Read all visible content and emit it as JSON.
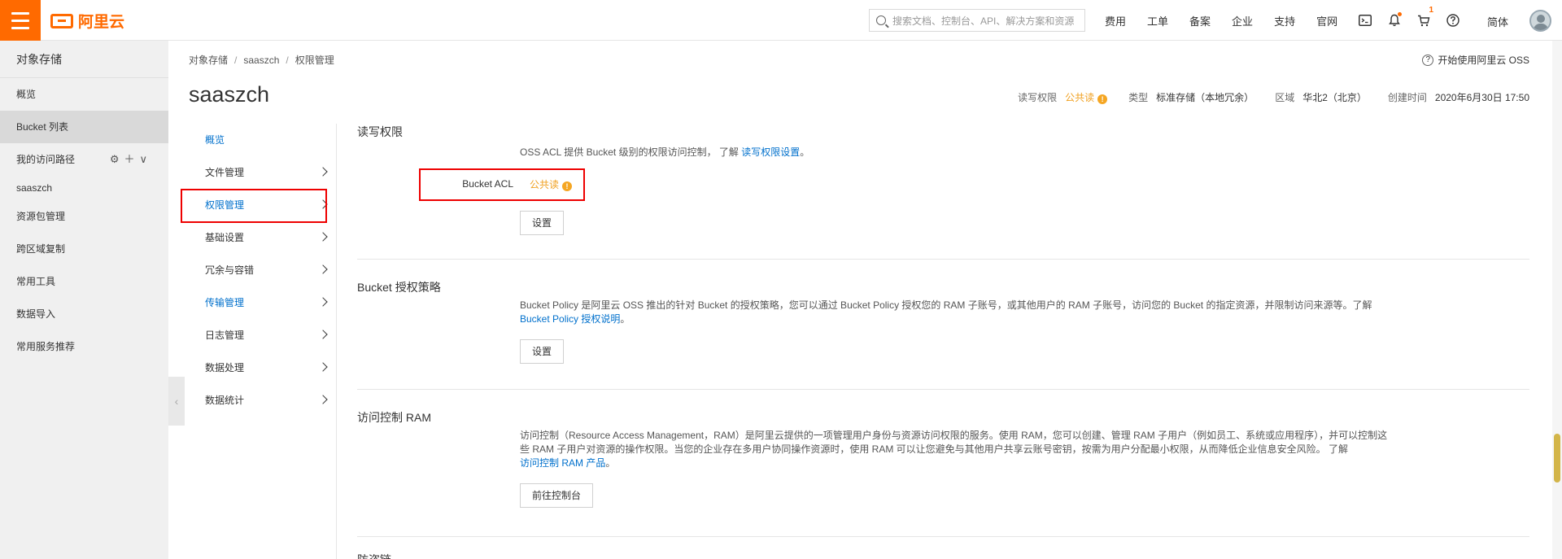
{
  "topbar": {
    "logo_text": "阿里云",
    "search_placeholder": "搜索文档、控制台、API、解决方案和资源",
    "nav": [
      "费用",
      "工单",
      "备案",
      "企业",
      "支持",
      "官网"
    ],
    "cart_badge": "1",
    "lang": "简体"
  },
  "sidebar": {
    "title": "对象存储",
    "items": {
      "overview": "概览",
      "bucket_list": "Bucket 列表",
      "my_paths": "我的访问路径",
      "path_bucket": "saaszch",
      "resource_pkg": "资源包管理",
      "cross_region": "跨区域复制",
      "tools": "常用工具",
      "import": "数据导入",
      "services": "常用服务推荐"
    }
  },
  "breadcrumb": [
    "对象存储",
    "saaszch",
    "权限管理"
  ],
  "help_link": "开始使用阿里云 OSS",
  "page_title": "saaszch",
  "meta": {
    "acl_label": "读写权限",
    "acl_value": "公共读",
    "type_label": "类型",
    "type_value": "标准存储（本地冗余）",
    "region_label": "区域",
    "region_value": "华北2（北京）",
    "created_label": "创建时间",
    "created_value": "2020年6月30日 17:50"
  },
  "subnav": [
    "概览",
    "文件管理",
    "权限管理",
    "基础设置",
    "冗余与容错",
    "传输管理",
    "日志管理",
    "数据处理",
    "数据统计"
  ],
  "sections": {
    "acl": {
      "title": "读写权限",
      "desc": "OSS ACL 提供 Bucket 级别的权限访问控制， 了解 ",
      "desc_link": "读写权限设置",
      "desc_end": "。",
      "row_label": "Bucket ACL",
      "row_value": "公共读",
      "button": "设置"
    },
    "policy": {
      "title": "Bucket 授权策略",
      "desc": "Bucket Policy 是阿里云 OSS 推出的针对 Bucket 的授权策略，您可以通过 Bucket Policy 授权您的 RAM 子账号，或其他用户的 RAM 子账号，访问您的 Bucket 的指定资源，并限制访问来源等。了解",
      "desc_link": "Bucket Policy 授权说明",
      "desc_end": "。",
      "button": "设置"
    },
    "ram": {
      "title": "访问控制 RAM",
      "desc": "访问控制（Resource Access Management，RAM）是阿里云提供的一项管理用户身份与资源访问权限的服务。使用 RAM，您可以创建、管理 RAM 子用户（例如员工、系统或应用程序），并可以控制这些 RAM 子用户对资源的操作权限。当您的企业存在多用户协同操作资源时，使用 RAM 可以让您避免与其他用户共享云账号密钥，按需为用户分配最小权限，从而降低企业信息安全风险。 了解",
      "desc_link": "访问控制 RAM 产品",
      "desc_end": "。",
      "button": "前往控制台"
    },
    "hotlink": {
      "title": "防盗链"
    }
  },
  "colors": {
    "brand": "#ff6a00",
    "link": "#0070cc",
    "warn": "#f0a020",
    "highlight": "#ee0000"
  }
}
